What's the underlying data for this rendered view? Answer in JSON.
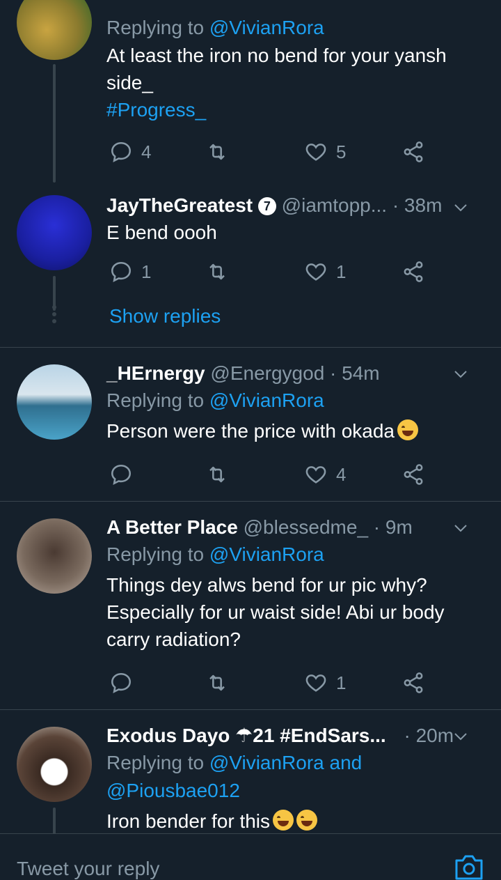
{
  "tweets": [
    {
      "replying_label": "Replying to",
      "replying_to": "@VivianRora",
      "text": "At least the iron no bend for your yansh side_",
      "hashtag": "#Progress_",
      "replies": "4",
      "retweets": "",
      "likes": "5"
    },
    {
      "name": "JayTheGreatest",
      "badge": "7",
      "handle": "@iamtopp...",
      "time": "· 38m",
      "text": "E bend oooh",
      "replies": "1",
      "retweets": "",
      "likes": "1",
      "show_replies": "Show replies"
    },
    {
      "name": "_HErnergy",
      "handle": "@Energygod",
      "time": "· 54m",
      "replying_label": "Replying to",
      "replying_to": "@VivianRora",
      "text": "Person were the price with  okada",
      "replies": "",
      "retweets": "",
      "likes": "4"
    },
    {
      "name": "A Better Place",
      "handle": "@blessedme_",
      "time": "· 9m",
      "replying_label": "Replying to",
      "replying_to": "@VivianRora",
      "text_line1": "Things dey alws bend for ur pic why?",
      "text_line2": "Especially for ur waist side! Abi ur body",
      "text_line3": "carry radiation?",
      "replies": "",
      "retweets": "",
      "likes": "1"
    },
    {
      "name": "Exodus Dayo ☂21 #EndSars...",
      "time": "· 20m",
      "replying_label": "Replying to",
      "replying_to": "@VivianRora and",
      "replying_to2": "@Piousbae012",
      "text": "Iron bender for this"
    }
  ],
  "composer": {
    "placeholder": "Tweet your reply"
  },
  "colors": {
    "background": "#15202b",
    "accent": "#1da1f2",
    "muted": "#8899a6",
    "divider": "#38444d"
  },
  "icons": [
    "reply-icon",
    "retweet-icon",
    "like-icon",
    "share-icon",
    "chevron-down-icon",
    "camera-icon"
  ]
}
